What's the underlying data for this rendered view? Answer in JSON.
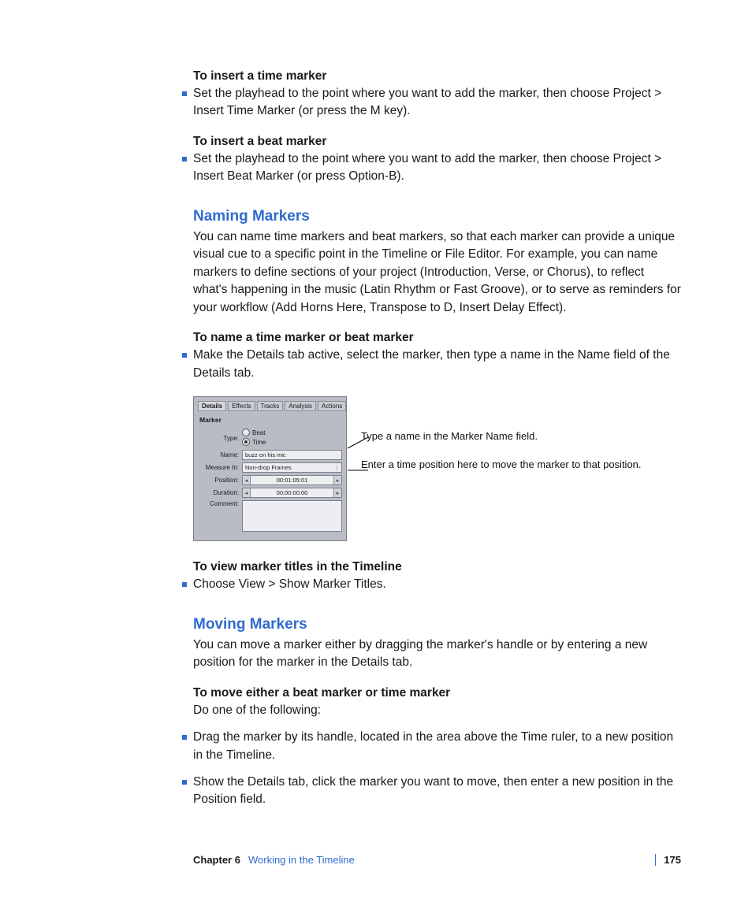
{
  "sections": {
    "insertTime": {
      "head": "To insert a time marker",
      "bullet": "Set the playhead to the point where you want to add the marker, then choose Project > Insert Time Marker (or press the M key)."
    },
    "insertBeat": {
      "head": "To insert a beat marker",
      "bullet": "Set the playhead to the point where you want to add the marker, then choose Project > Insert Beat Marker (or press Option-B)."
    },
    "naming": {
      "title": "Naming Markers",
      "para": "You can name time markers and beat markers, so that each marker can provide a unique visual cue to a specific point in the Timeline or File Editor. For example, you can name markers to define sections of your project (Introduction, Verse, or Chorus), to reflect what's happening in the music (Latin Rhythm or Fast Groove), or to serve as reminders for your workflow (Add Horns Here, Transpose to D, Insert Delay Effect).",
      "nameHead": "To name a time marker or beat marker",
      "nameBullet": "Make the Details tab active, select the marker, then type a name in the Name field of the Details tab.",
      "viewHead": "To view marker titles in the Timeline",
      "viewBullet": "Choose View > Show Marker Titles."
    },
    "moving": {
      "title": "Moving Markers",
      "para": "You can move a marker either by dragging the marker's handle or by entering a new position for the marker in the Details tab.",
      "moveHead": "To move either a beat marker or time marker",
      "moveIntro": "Do one of the following:",
      "bullets": [
        "Drag the marker by its handle, located in the area above the Time ruler, to a new position in the Timeline.",
        "Show the Details tab, click the marker you want to move, then enter a new position in the Position field."
      ]
    }
  },
  "panel": {
    "tabs": [
      "Details",
      "Effects",
      "Tracks",
      "Analysis",
      "Actions"
    ],
    "groupLabel": "Marker",
    "labels": {
      "type": "Type:",
      "beat": "Beat",
      "time": "Time",
      "name": "Name:",
      "measure": "Measure In:",
      "position": "Position:",
      "duration": "Duration:",
      "comment": "Comment:"
    },
    "values": {
      "name": "buzz on his mic",
      "measure": "Non-drop Frames",
      "position": "00:01:05:01",
      "duration": "00:00:00:00"
    }
  },
  "callouts": {
    "a": "Type a name in the Marker Name field.",
    "b": "Enter a time position here to move the marker to that position."
  },
  "footer": {
    "chapter": "Chapter 6",
    "title": "Working in the Timeline",
    "page": "175"
  }
}
